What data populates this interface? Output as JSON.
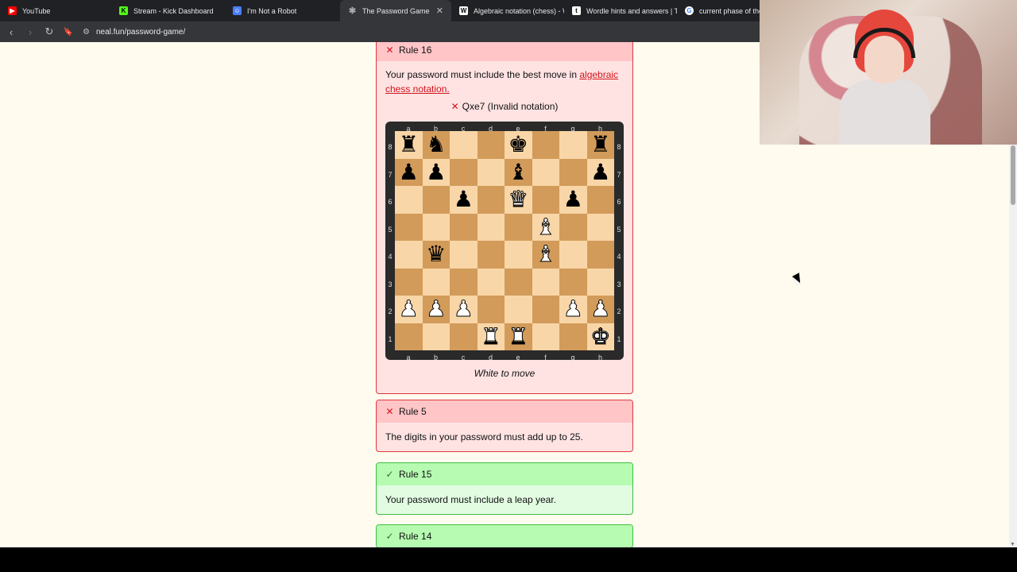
{
  "tabs": [
    {
      "title": "YouTube",
      "favicon": "youtube-icon",
      "color": "#ff0000"
    },
    {
      "title": "Stream - Kick Dashboard",
      "favicon": "kick-icon",
      "color": "#53fc18"
    },
    {
      "title": "I'm Not a Robot",
      "favicon": "robot-icon",
      "color": "#4a7dff"
    },
    {
      "title": "The Password Game",
      "favicon": "asterisk-icon",
      "color": "#555555"
    },
    {
      "title": "Algebraic notation (chess) - Wi",
      "favicon": "wikipedia-icon",
      "color": "#ffffff"
    },
    {
      "title": "Wordle hints and answers | Tom",
      "favicon": "t-icon",
      "color": "#ffffff"
    },
    {
      "title": "current phase of the m",
      "favicon": "google-icon",
      "color": "#ffffff"
    }
  ],
  "address": {
    "url": "neal.fun/password-game/"
  },
  "rule16": {
    "title": "Rule 16",
    "text": "Your password must include the best move in ",
    "link": "algebraic chess notation.",
    "status": "Qxe7 (Invalid notation)",
    "caption": "White to move"
  },
  "rule5": {
    "title": "Rule 5",
    "text": "The digits in your password must add up to 25."
  },
  "rule15": {
    "title": "Rule 15",
    "text": "Your password must include a leap year."
  },
  "rule14": {
    "title": "Rule 14"
  },
  "board": {
    "files": [
      "a",
      "b",
      "c",
      "d",
      "e",
      "f",
      "g",
      "h"
    ],
    "ranks": [
      "8",
      "7",
      "6",
      "5",
      "4",
      "3",
      "2",
      "1"
    ],
    "position": [
      [
        "bR",
        "bN",
        "",
        "",
        "bK",
        "",
        "",
        "bR"
      ],
      [
        "bP",
        "bP",
        "",
        "",
        "bB",
        "",
        "",
        "bP"
      ],
      [
        "",
        "",
        "bP",
        "",
        "wQ",
        "",
        "bP",
        ""
      ],
      [
        "",
        "",
        "",
        "",
        "",
        "wB",
        "",
        ""
      ],
      [
        "",
        "bQ",
        "",
        "",
        "",
        "wB",
        "",
        ""
      ],
      [
        "",
        "",
        "",
        "",
        "",
        "",
        "",
        ""
      ],
      [
        "wP",
        "wP",
        "wP",
        "",
        "",
        "",
        "wP",
        "wP"
      ],
      [
        "",
        "",
        "",
        "wR",
        "wR",
        "",
        "",
        "wK"
      ]
    ]
  }
}
